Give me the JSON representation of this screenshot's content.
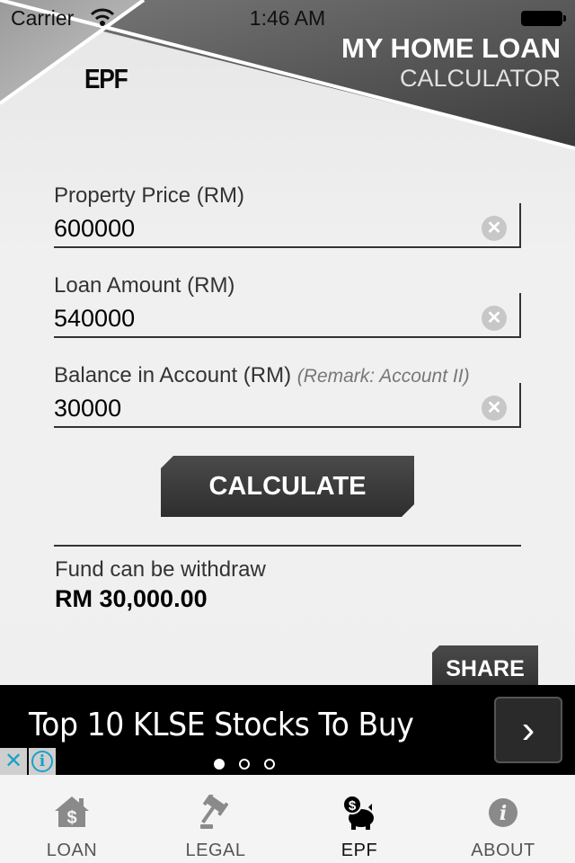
{
  "status_bar": {
    "carrier": "Carrier",
    "time": "1:46 AM"
  },
  "header": {
    "page_title": "EPF",
    "app_title_line1": "MY HOME LOAN",
    "app_title_line2": "CALCULATOR"
  },
  "form": {
    "fields": [
      {
        "label": "Property Price (RM)",
        "remark": "",
        "value": "600000"
      },
      {
        "label": "Loan Amount (RM)",
        "remark": "",
        "value": "540000"
      },
      {
        "label": "Balance in Account (RM)",
        "remark": "(Remark: Account II)",
        "value": "30000"
      }
    ],
    "clear_glyph": "✕",
    "calculate_label": "CALCULATE"
  },
  "result": {
    "label": "Fund can be withdraw",
    "value": "RM 30,000.00",
    "share_label": "SHARE"
  },
  "ad": {
    "text": "Top 10 KLSE Stocks To Buy",
    "arrow_glyph": "›",
    "close_glyph": "✕",
    "info_glyph": "i",
    "page_count": 3,
    "active_page": 1
  },
  "tabbar": {
    "tabs": [
      {
        "label": "LOAN",
        "icon": "house-dollar-icon",
        "active": false
      },
      {
        "label": "LEGAL",
        "icon": "gavel-icon",
        "active": false
      },
      {
        "label": "EPF",
        "icon": "piggy-bank-icon",
        "active": true
      },
      {
        "label": "ABOUT",
        "icon": "info-icon",
        "active": false
      }
    ]
  },
  "colors": {
    "accent_dark": "#333333",
    "ad_link": "#1aa0c8",
    "tab_inactive": "#8a8a8a",
    "tab_active": "#111111"
  }
}
